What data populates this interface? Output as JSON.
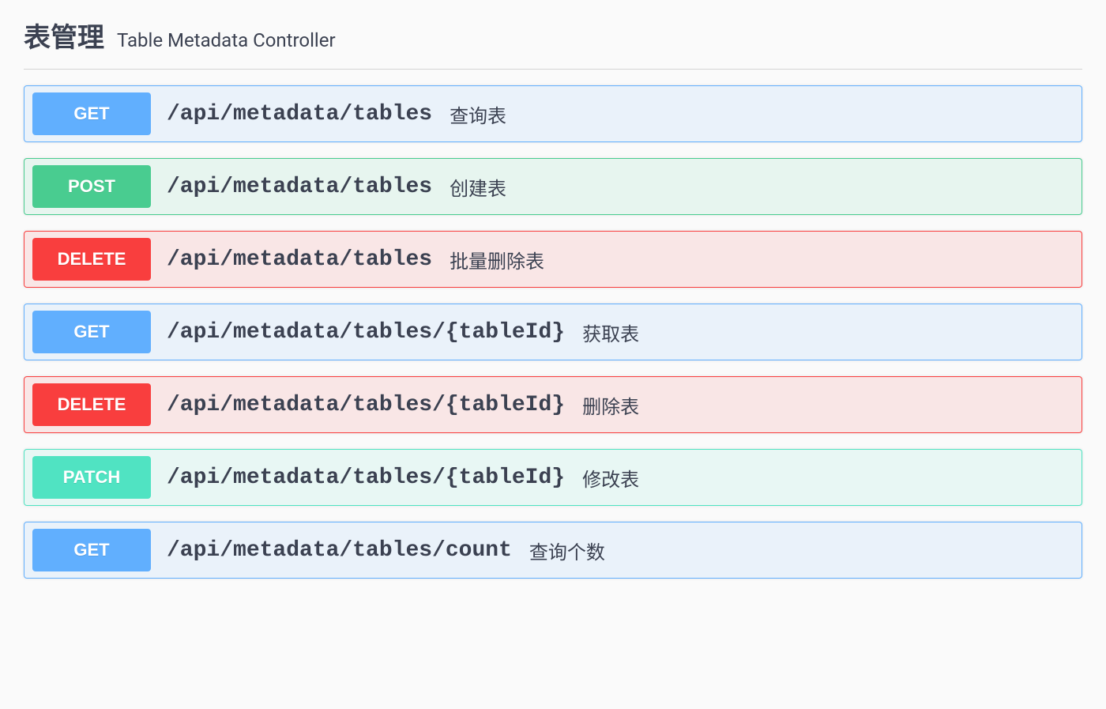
{
  "section": {
    "title": "表管理",
    "subtitle": "Table Metadata Controller"
  },
  "endpoints": [
    {
      "method": "GET",
      "path": "/api/metadata/tables",
      "desc": "查询表"
    },
    {
      "method": "POST",
      "path": "/api/metadata/tables",
      "desc": "创建表"
    },
    {
      "method": "DELETE",
      "path": "/api/metadata/tables",
      "desc": "批量删除表"
    },
    {
      "method": "GET",
      "path": "/api/metadata/tables/{tableId}",
      "desc": "获取表"
    },
    {
      "method": "DELETE",
      "path": "/api/metadata/tables/{tableId}",
      "desc": "删除表"
    },
    {
      "method": "PATCH",
      "path": "/api/metadata/tables/{tableId}",
      "desc": "修改表"
    },
    {
      "method": "GET",
      "path": "/api/metadata/tables/count",
      "desc": "查询个数"
    }
  ]
}
